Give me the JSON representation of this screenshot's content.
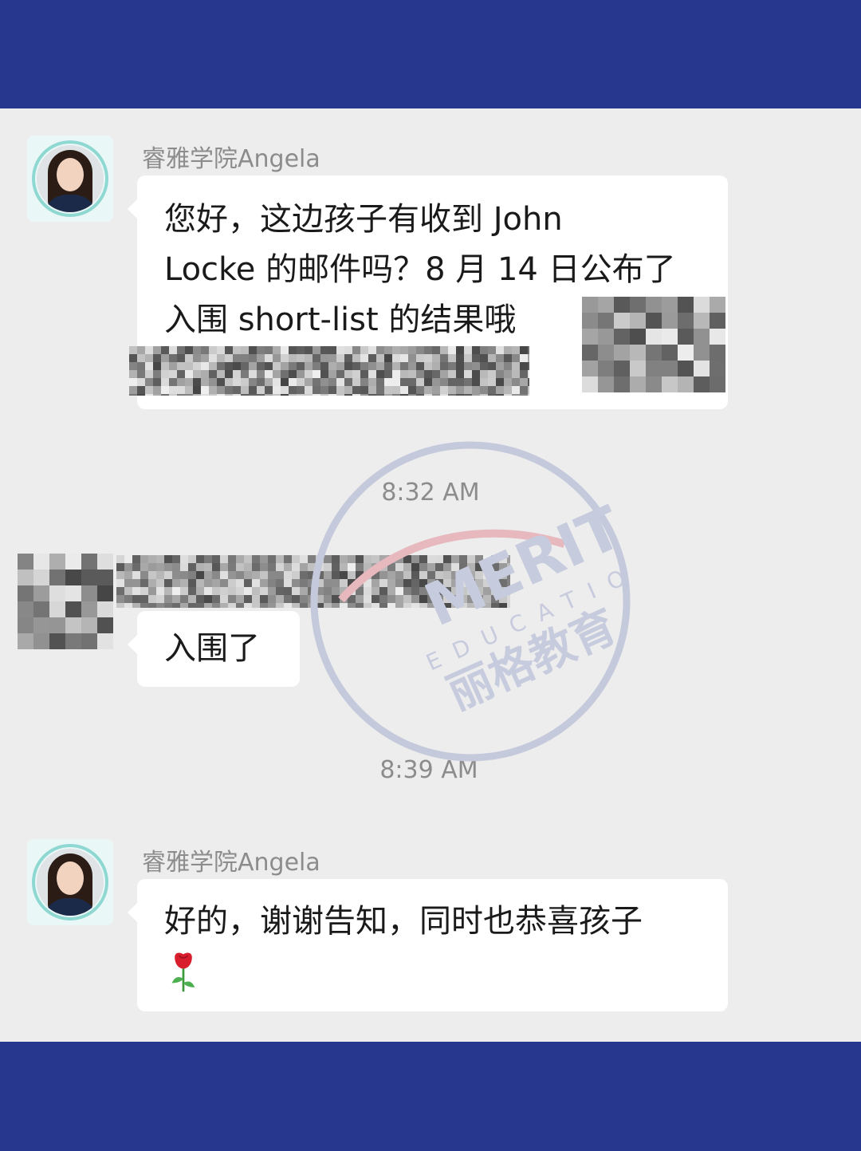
{
  "colors": {
    "band": "#27378e",
    "chat_bg": "#ededed",
    "bubble": "#ffffff",
    "meta_text": "#8c8c8c"
  },
  "messages": [
    {
      "sender": "睿雅学院Angela",
      "lines": [
        "您好，这边孩子有收到 John",
        "Locke 的邮件吗？8 月 14 日公布了",
        "入围 short-list 的结果哦"
      ],
      "attachment": "redacted-screenshot"
    },
    {
      "timestamp": "8:32 AM"
    },
    {
      "text": "入围了",
      "attachment": "redacted-screenshot"
    },
    {
      "timestamp": "8:39 AM"
    },
    {
      "sender": "睿雅学院Angela",
      "text": "好的，谢谢告知，同时也恭喜孩子",
      "emoji": "rose-emoji"
    }
  ],
  "watermark": {
    "brand_latin": "MERIT",
    "tagline": "EDUCATION",
    "brand_cn": "丽格教育"
  }
}
